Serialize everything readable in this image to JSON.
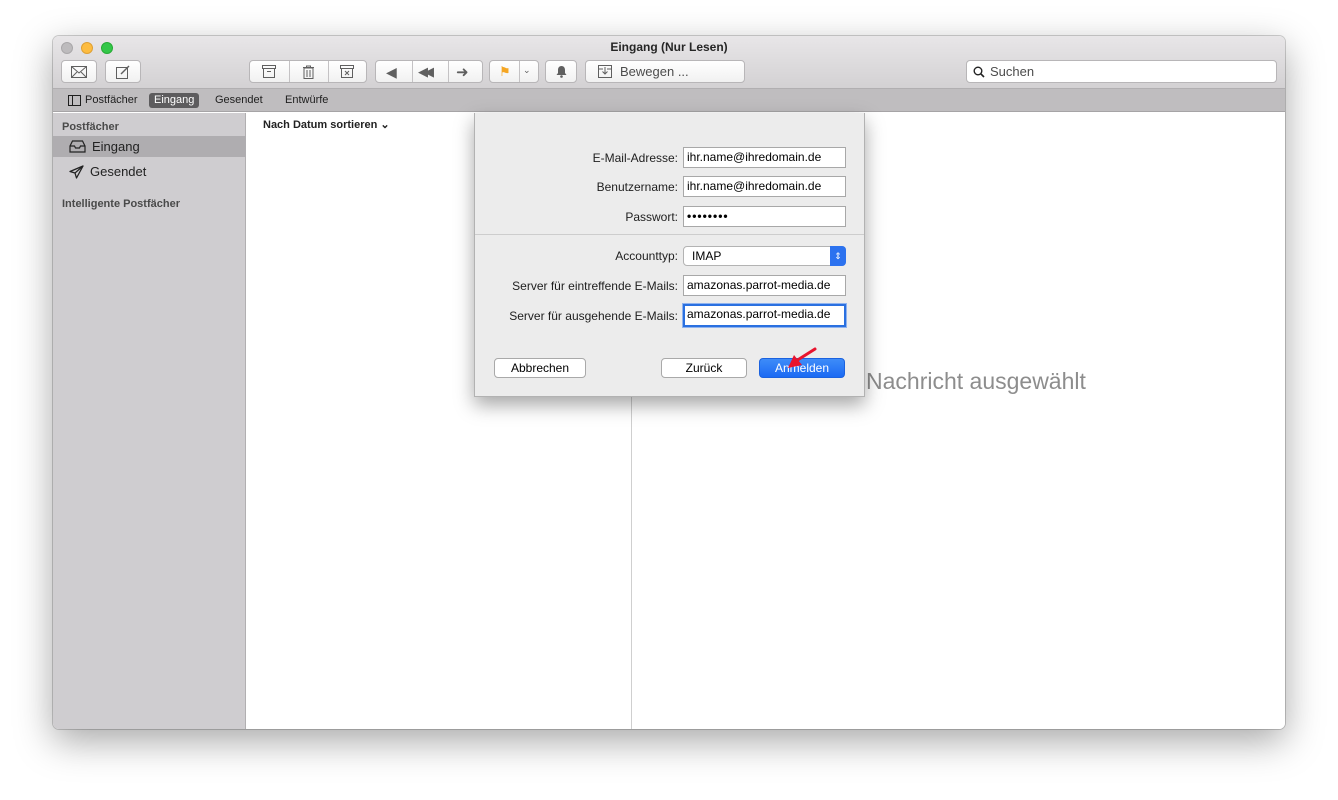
{
  "window": {
    "title": "Eingang (Nur Lesen)"
  },
  "toolbar": {
    "move_label": "Bewegen ...",
    "search_placeholder": "Suchen"
  },
  "favorites": {
    "mailboxes_label": "Postfächer",
    "items": [
      "Eingang",
      "Gesendet",
      "Entwürfe"
    ]
  },
  "sidebar": {
    "section_mailboxes": "Postfächer",
    "items": [
      "Eingang",
      "Gesendet"
    ],
    "section_smart": "Intelligente Postfächer"
  },
  "message_list": {
    "sort_label": "Nach Datum sortieren"
  },
  "content": {
    "empty_text_visible": "Nachricht ausgewählt"
  },
  "dialog": {
    "email_label": "E-Mail-Adresse:",
    "email_value": "ihr.name@ihredomain.de",
    "username_label": "Benutzername:",
    "username_value": "ihr.name@ihredomain.de",
    "password_label": "Passwort:",
    "password_value": "••••••••",
    "account_type_label": "Accounttyp:",
    "account_type_value": "IMAP",
    "incoming_label": "Server für eintreffende E-Mails:",
    "incoming_value": "amazonas.parrot-media.de",
    "outgoing_label": "Server für ausgehende E-Mails:",
    "outgoing_value": "amazonas.parrot-media.de",
    "cancel_label": "Abbrechen",
    "back_label": "Zurück",
    "signin_label": "Anmelden"
  },
  "colors": {
    "primary_button": "#1b6af3",
    "focus_ring": "#2a70e0",
    "annotation_arrow": "#e8142e",
    "flag": "#f5a623"
  }
}
